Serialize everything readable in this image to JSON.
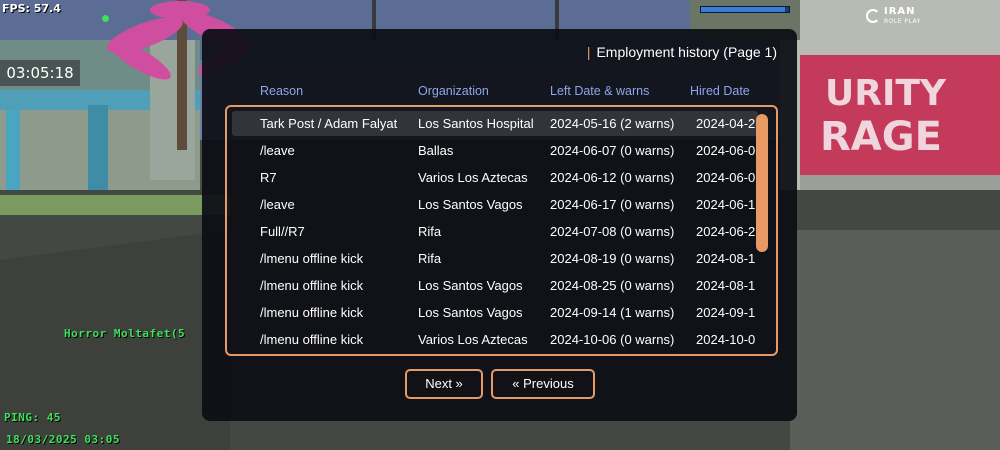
{
  "hud": {
    "fps": "FPS: 57.4",
    "clock": "03:05:18",
    "player_tag": "Horror Moltafet(5",
    "ping": "PING: 45",
    "datetime": "18/03/2025 03:05",
    "server_logo_line1": "IRAN",
    "server_logo_line2": "ROLE PLAY",
    "health_fraction": 0.95
  },
  "background_sign": {
    "line1": "URITY",
    "line2": "RAGE"
  },
  "dialog": {
    "title": "Employment history (Page 1)",
    "title_bar": "|",
    "columns": [
      "Reason",
      "Organization",
      "Left Date & warns",
      "Hired Date"
    ],
    "rows": [
      {
        "reason": "Tark Post / Adam Falyat",
        "organization": "Los Santos Hospital",
        "left": "2024-05-16 (2 warns)",
        "hired": "2024-04-2",
        "selected": true
      },
      {
        "reason": "/leave",
        "organization": "Ballas",
        "left": "2024-06-07 (0 warns)",
        "hired": "2024-06-0",
        "selected": false
      },
      {
        "reason": "R7",
        "organization": "Varios Los Aztecas",
        "left": "2024-06-12 (0 warns)",
        "hired": "2024-06-0",
        "selected": false
      },
      {
        "reason": "/leave",
        "organization": "Los Santos Vagos",
        "left": "2024-06-17 (0 warns)",
        "hired": "2024-06-1",
        "selected": false
      },
      {
        "reason": "Full//R7",
        "organization": "Rifa",
        "left": "2024-07-08 (0 warns)",
        "hired": "2024-06-2",
        "selected": false
      },
      {
        "reason": "/lmenu offline kick",
        "organization": "Rifa",
        "left": "2024-08-19 (0 warns)",
        "hired": "2024-08-1",
        "selected": false
      },
      {
        "reason": "/lmenu offline kick",
        "organization": "Los Santos Vagos",
        "left": "2024-08-25 (0 warns)",
        "hired": "2024-08-1",
        "selected": false
      },
      {
        "reason": "/lmenu offline kick",
        "organization": "Los Santos Vagos",
        "left": "2024-09-14 (1 warns)",
        "hired": "2024-09-1",
        "selected": false
      },
      {
        "reason": "/lmenu offline kick",
        "organization": "Varios Los Aztecas",
        "left": "2024-10-06 (0 warns)",
        "hired": "2024-10-0",
        "selected": false
      }
    ],
    "next_label": "Next »",
    "prev_label": "« Previous",
    "accent_color": "#e79a64",
    "header_color": "#8fa6ea"
  }
}
